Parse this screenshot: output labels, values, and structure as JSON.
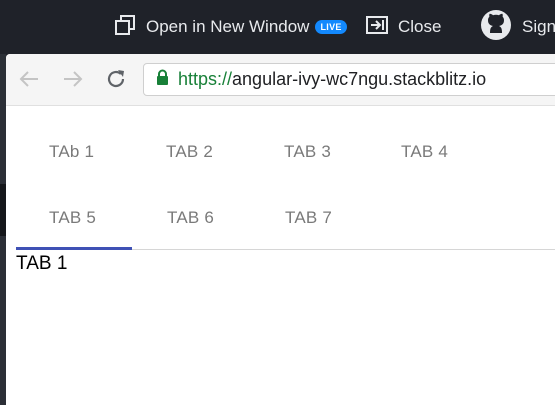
{
  "topbar": {
    "open_new_window_label": "Open in New Window",
    "live_badge": "LIVE",
    "close_label": "Close",
    "sign_label": "Sign"
  },
  "addressbar": {
    "url_scheme": "https://",
    "url_rest": "angular-ivy-wc7ngu.stackblitz.io"
  },
  "tabs": [
    {
      "label": "TAb 1"
    },
    {
      "label": "TAB 2"
    },
    {
      "label": "TAB 3"
    },
    {
      "label": "TAB 4"
    },
    {
      "label": "TAB 5"
    },
    {
      "label": "TAB 6"
    },
    {
      "label": "TAB 7"
    }
  ],
  "active_tab_index": 0,
  "tab_content": "TAB 1",
  "colors": {
    "accent_ink_bar": "#3f51b5",
    "live_badge": "#1389fd",
    "secure_green": "#188038"
  },
  "icons": [
    "open-new-window-icon",
    "close-icon",
    "github-icon",
    "back-arrow-icon",
    "forward-arrow-icon",
    "reload-icon",
    "lock-icon"
  ]
}
